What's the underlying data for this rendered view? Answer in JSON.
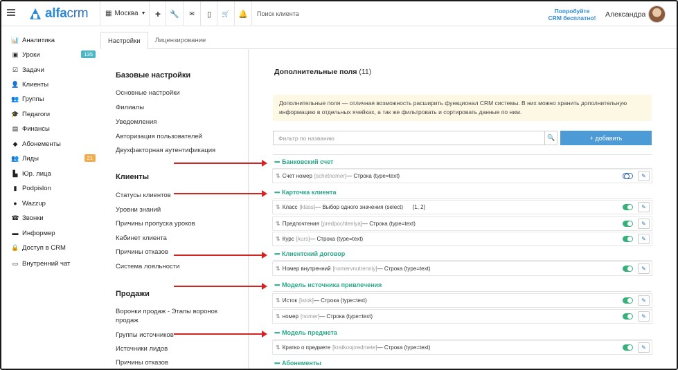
{
  "header": {
    "logo_text_1": "alfa",
    "logo_text_2": "crm",
    "branch": "Москва",
    "search_placeholder": "Поиск клиента",
    "promo_line1": "Попробуйте",
    "promo_line2": "CRM бесплатно!",
    "user_name": "Александра"
  },
  "sidebar": {
    "items": [
      {
        "label": "Аналитика",
        "icon": "chart-icon",
        "glyph": "📊"
      },
      {
        "label": "Уроки",
        "icon": "calendar-icon",
        "glyph": "▣",
        "badge": "135",
        "badge_color": "#4db7c7"
      },
      {
        "label": "Задачи",
        "icon": "tasks-icon",
        "glyph": "☑"
      },
      {
        "label": "Клиенты",
        "icon": "user-icon",
        "glyph": "👤"
      },
      {
        "label": "Группы",
        "icon": "group-icon",
        "glyph": "👥"
      },
      {
        "label": "Педагоги",
        "icon": "graduation-icon",
        "glyph": "🎓"
      },
      {
        "label": "Финансы",
        "icon": "money-icon",
        "glyph": "▤"
      },
      {
        "label": "Абонементы",
        "icon": "tag-icon",
        "glyph": "◆"
      },
      {
        "label": "Лиды",
        "icon": "leads-icon",
        "glyph": "👥",
        "badge": "21",
        "badge_color": "#f0ad4e"
      },
      {
        "label": "Юр. лица",
        "icon": "legal-icon",
        "glyph": "▙"
      },
      {
        "label": "Podpislon",
        "icon": "document-icon",
        "glyph": "▮"
      },
      {
        "label": "Wazzup",
        "icon": "whatsapp-icon",
        "glyph": "●"
      },
      {
        "label": "Звонки",
        "icon": "phone-icon",
        "glyph": "☎"
      },
      {
        "label": "Информер",
        "icon": "informer-icon",
        "glyph": "▬"
      },
      {
        "label": "Доступ в CRM",
        "icon": "lock-icon",
        "glyph": "🔒"
      },
      {
        "label": "Внутренний чат",
        "icon": "chat-icon",
        "glyph": "▭"
      }
    ]
  },
  "tabs": [
    {
      "label": "Настройки",
      "active": true
    },
    {
      "label": "Лицензирование",
      "active": false
    }
  ],
  "settings": {
    "sections": [
      {
        "title": "Базовые настройки",
        "links": [
          "Основные настройки",
          "Филиалы",
          "Уведомления",
          "Авторизация пользователей",
          "Двухфакторная аутентификация"
        ]
      },
      {
        "title": "Клиенты",
        "links": [
          "Статусы клиентов",
          "Уровни знаний",
          "Причины пропуска уроков",
          "Кабинет клиента",
          "Причины отказов",
          "Система лояльности"
        ]
      },
      {
        "title": "Продажи",
        "links": [
          "Воронки продаж - Этапы воронок продаж",
          "Группы источников",
          "Источники лидов",
          "Причины отказов"
        ]
      }
    ]
  },
  "main": {
    "title": "Дополнительные поля",
    "count": "(11)",
    "info_text": "Дополнительные поля — отличная возможность расширить функционал CRM системы. В них можно хранить дополнительную информацию в отдельных ячейках, а так же фильтровать и сортировать данные по ним.",
    "filter_placeholder": "Фильтр по названию",
    "add_label": "+ добавить",
    "groups": [
      {
        "title": "Банковский счет",
        "fields": [
          {
            "name": "Счет номер",
            "key": "[schetnomer]",
            "type": " — Строка (type=text)",
            "extra": "",
            "enabled": false
          }
        ]
      },
      {
        "title": "Карточка клиента",
        "fields": [
          {
            "name": "Класс",
            "key": "[klass]",
            "type": " — Выбор одного значения (select)",
            "extra": "[1, 2]",
            "enabled": true
          },
          {
            "name": "Предпочтения",
            "key": "[predpochteniya]",
            "type": " — Строка (type=text)",
            "extra": "",
            "enabled": true
          },
          {
            "name": "Курс",
            "key": "[kurs]",
            "type": " — Строка (type=text)",
            "extra": "",
            "enabled": true
          }
        ]
      },
      {
        "title": "Клиентский договор",
        "fields": [
          {
            "name": "Номер внутренний",
            "key": "[nomervnutrenniy]",
            "type": " — Строка (type=text)",
            "extra": "",
            "enabled": true
          }
        ]
      },
      {
        "title": "Модель источника привлечения",
        "fields": [
          {
            "name": "Исток",
            "key": "[istok]",
            "type": " — Строка (type=text)",
            "extra": "",
            "enabled": true
          },
          {
            "name": "номер",
            "key": "[nomer]",
            "type": " — Строка (type=text)",
            "extra": "",
            "enabled": true
          }
        ]
      },
      {
        "title": "Модель предмета",
        "fields": [
          {
            "name": "Кратко о предмете",
            "key": "[kratkoopredmete]",
            "type": " — Строка (type=text)",
            "extra": "",
            "enabled": true
          }
        ]
      },
      {
        "title": "Абонементы",
        "fields": []
      }
    ]
  },
  "colors": {
    "accent": "#2b8ad6",
    "group_title": "#2aa88a",
    "arrow": "#d32323",
    "toggle_on": "#37b07a"
  }
}
